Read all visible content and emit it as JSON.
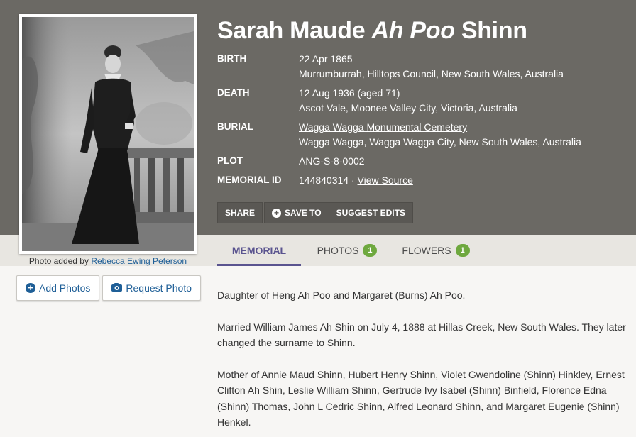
{
  "memorial": {
    "name_first": "Sarah Maude",
    "name_italic": "Ah Poo",
    "name_last": "Shinn",
    "facts": [
      {
        "label": "BIRTH",
        "line1": "22 Apr 1865",
        "line2": "Murrumburrah, Hilltops Council, New South Wales, Australia"
      },
      {
        "label": "DEATH",
        "line1": "12 Aug 1936 (aged 71)",
        "line2": "Ascot Vale, Moonee Valley City, Victoria, Australia"
      },
      {
        "label": "BURIAL",
        "line1": "Wagga Wagga Monumental Cemetery",
        "line2": "Wagga Wagga, Wagga Wagga City, New South Wales, Australia"
      },
      {
        "label": "PLOT",
        "line1": "ANG-S-8-0002"
      },
      {
        "label": "MEMORIAL ID",
        "line1": "144840314",
        "separator": "·",
        "link": "View Source"
      }
    ]
  },
  "photo": {
    "caption_prefix": "Photo added by",
    "caption_author": "Rebecca Ewing Peterson",
    "icon": "portrait-photo"
  },
  "actions": {
    "share": "SHARE",
    "save_to": "SAVE TO",
    "suggest_edits": "SUGGEST EDITS"
  },
  "tabs": [
    {
      "label": "MEMORIAL",
      "active": true
    },
    {
      "label": "PHOTOS",
      "count": "1"
    },
    {
      "label": "FLOWERS",
      "count": "1"
    }
  ],
  "photo_buttons": {
    "add": "Add Photos",
    "request": "Request Photo"
  },
  "bio": [
    "Daughter of Heng Ah Poo and Margaret (Burns) Ah Poo.",
    "Married William James Ah Shin on July 4, 1888 at Hillas Creek, New South Wales. They later changed the surname to Shinn.",
    "Mother of Annie Maud Shinn, Hubert Henry Shinn, Violet Gwendoline (Shinn) Hinkley, Ernest Clifton Ah Shin, Leslie William Shinn, Gertrude Ivy Isabel (Shinn) Binfield, Florence Edna (Shinn) Thomas, John L Cedric Shinn, Alfred Leonard Shinn, and Margaret Eugenie (Shinn) Henkel."
  ],
  "colors": {
    "header_bg": "#6b6964",
    "tab_active": "#5a548f",
    "badge": "#6ea83e",
    "link": "#1f5f97"
  }
}
